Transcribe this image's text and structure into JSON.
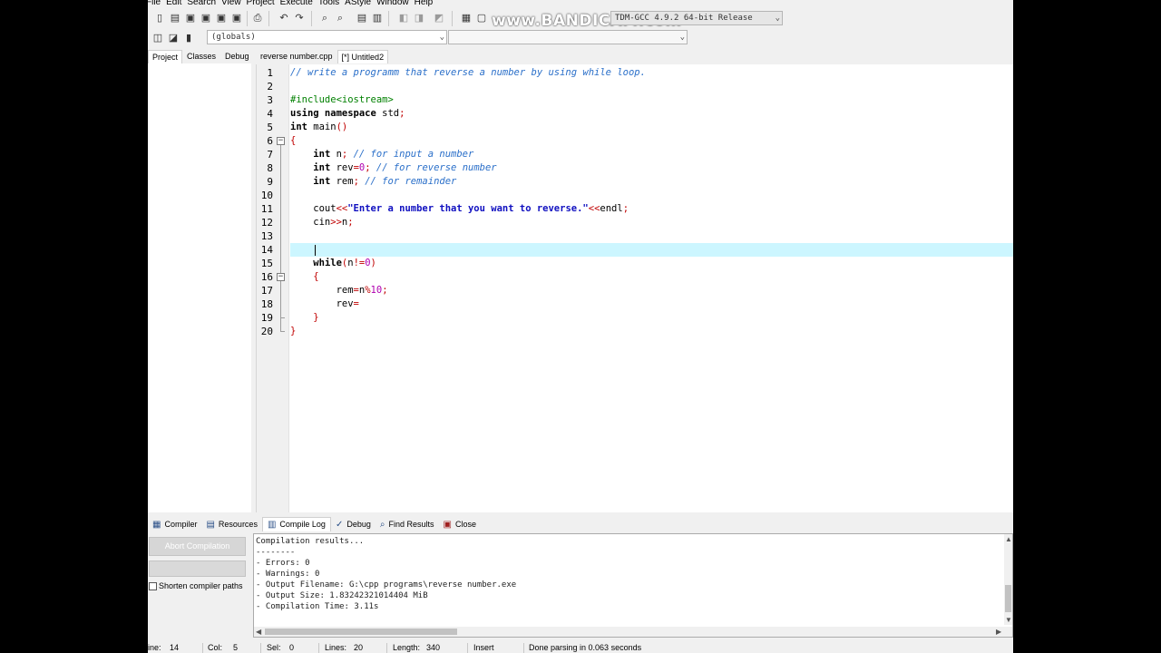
{
  "watermark": "www.BANDICAM.com",
  "menu": [
    "File",
    "Edit",
    "Search",
    "View",
    "Project",
    "Execute",
    "Tools",
    "AStyle",
    "Window",
    "Help"
  ],
  "toolbar": {
    "compiler": "TDM-GCC 4.9.2 64-bit Release",
    "scope": "(globals)",
    "member": ""
  },
  "left_panel": {
    "tabs": [
      "Project",
      "Classes",
      "Debug"
    ]
  },
  "editor": {
    "tabs": [
      "reverse number.cpp",
      "[*] Untitled2"
    ],
    "current_line": 14,
    "lines": [
      [
        {
          "t": "// write a programm that reverse a number by using while loop.",
          "c": "cm"
        }
      ],
      [],
      [
        {
          "t": "#include<iostream>",
          "c": "pp"
        }
      ],
      [
        {
          "t": "using namespace",
          "c": "kw"
        },
        {
          "t": " std",
          "c": ""
        },
        {
          "t": ";",
          "c": "sy"
        }
      ],
      [
        {
          "t": "int",
          "c": "kw"
        },
        {
          "t": " main",
          "c": ""
        },
        {
          "t": "()",
          "c": "sy"
        }
      ],
      [
        {
          "t": "{",
          "c": "br"
        }
      ],
      [
        {
          "t": "    ",
          "c": ""
        },
        {
          "t": "int",
          "c": "kw"
        },
        {
          "t": " n",
          "c": ""
        },
        {
          "t": ";",
          "c": "sy"
        },
        {
          "t": " // for input a number",
          "c": "cm"
        }
      ],
      [
        {
          "t": "    ",
          "c": ""
        },
        {
          "t": "int",
          "c": "kw"
        },
        {
          "t": " rev",
          "c": ""
        },
        {
          "t": "=",
          "c": "sy"
        },
        {
          "t": "0",
          "c": "nm"
        },
        {
          "t": ";",
          "c": "sy"
        },
        {
          "t": " // for reverse number",
          "c": "cm"
        }
      ],
      [
        {
          "t": "    ",
          "c": ""
        },
        {
          "t": "int",
          "c": "kw"
        },
        {
          "t": " rem",
          "c": ""
        },
        {
          "t": ";",
          "c": "sy"
        },
        {
          "t": " // for remainder",
          "c": "cm"
        }
      ],
      [],
      [
        {
          "t": "    cout",
          "c": ""
        },
        {
          "t": "<<",
          "c": "sy"
        },
        {
          "t": "\"Enter a number that you want to reverse.\"",
          "c": "st"
        },
        {
          "t": "<<",
          "c": "sy"
        },
        {
          "t": "endl",
          "c": ""
        },
        {
          "t": ";",
          "c": "sy"
        }
      ],
      [
        {
          "t": "    cin",
          "c": ""
        },
        {
          "t": ">>",
          "c": "sy"
        },
        {
          "t": "n",
          "c": ""
        },
        {
          "t": ";",
          "c": "sy"
        }
      ],
      [],
      [],
      [
        {
          "t": "    ",
          "c": ""
        },
        {
          "t": "while",
          "c": "kw"
        },
        {
          "t": "(",
          "c": "sy"
        },
        {
          "t": "n",
          "c": ""
        },
        {
          "t": "!=",
          "c": "sy"
        },
        {
          "t": "0",
          "c": "nm"
        },
        {
          "t": ")",
          "c": "sy"
        }
      ],
      [
        {
          "t": "    ",
          "c": ""
        },
        {
          "t": "{",
          "c": "br"
        }
      ],
      [
        {
          "t": "        rem",
          "c": ""
        },
        {
          "t": "=",
          "c": "sy"
        },
        {
          "t": "n",
          "c": ""
        },
        {
          "t": "%",
          "c": "sy"
        },
        {
          "t": "10",
          "c": "nm"
        },
        {
          "t": ";",
          "c": "sy"
        }
      ],
      [
        {
          "t": "        rev",
          "c": ""
        },
        {
          "t": "=",
          "c": "sy"
        }
      ],
      [
        {
          "t": "    ",
          "c": ""
        },
        {
          "t": "}",
          "c": "br"
        }
      ],
      [
        {
          "t": "}",
          "c": "br"
        }
      ]
    ]
  },
  "bottom_panel": {
    "tabs": [
      {
        "label": "Compiler",
        "icon": "grid-icon"
      },
      {
        "label": "Resources",
        "icon": "resources-icon"
      },
      {
        "label": "Compile Log",
        "icon": "chart-icon"
      },
      {
        "label": "Debug",
        "icon": "check-icon"
      },
      {
        "label": "Find Results",
        "icon": "find-icon"
      },
      {
        "label": "Close",
        "icon": "close-icon"
      }
    ],
    "active_tab": "Compile Log",
    "abort_button": "Abort Compilation",
    "shorten_label": "Shorten compiler paths",
    "log": [
      "Compilation results...",
      "--------",
      "- Errors: 0",
      "- Warnings: 0",
      "- Output Filename: G:\\cpp programs\\reverse number.exe",
      "- Output Size: 1.83242321014404 MiB",
      "- Compilation Time: 3.11s"
    ]
  },
  "statusbar": {
    "line_label": "ine:",
    "line_value": "14",
    "col_label": "Col:",
    "col_value": "5",
    "sel_label": "Sel:",
    "sel_value": "0",
    "lines_label": "Lines:",
    "lines_value": "20",
    "length_label": "Length:",
    "length_value": "340",
    "mode": "Insert",
    "message": "Done parsing in 0.063 seconds"
  }
}
